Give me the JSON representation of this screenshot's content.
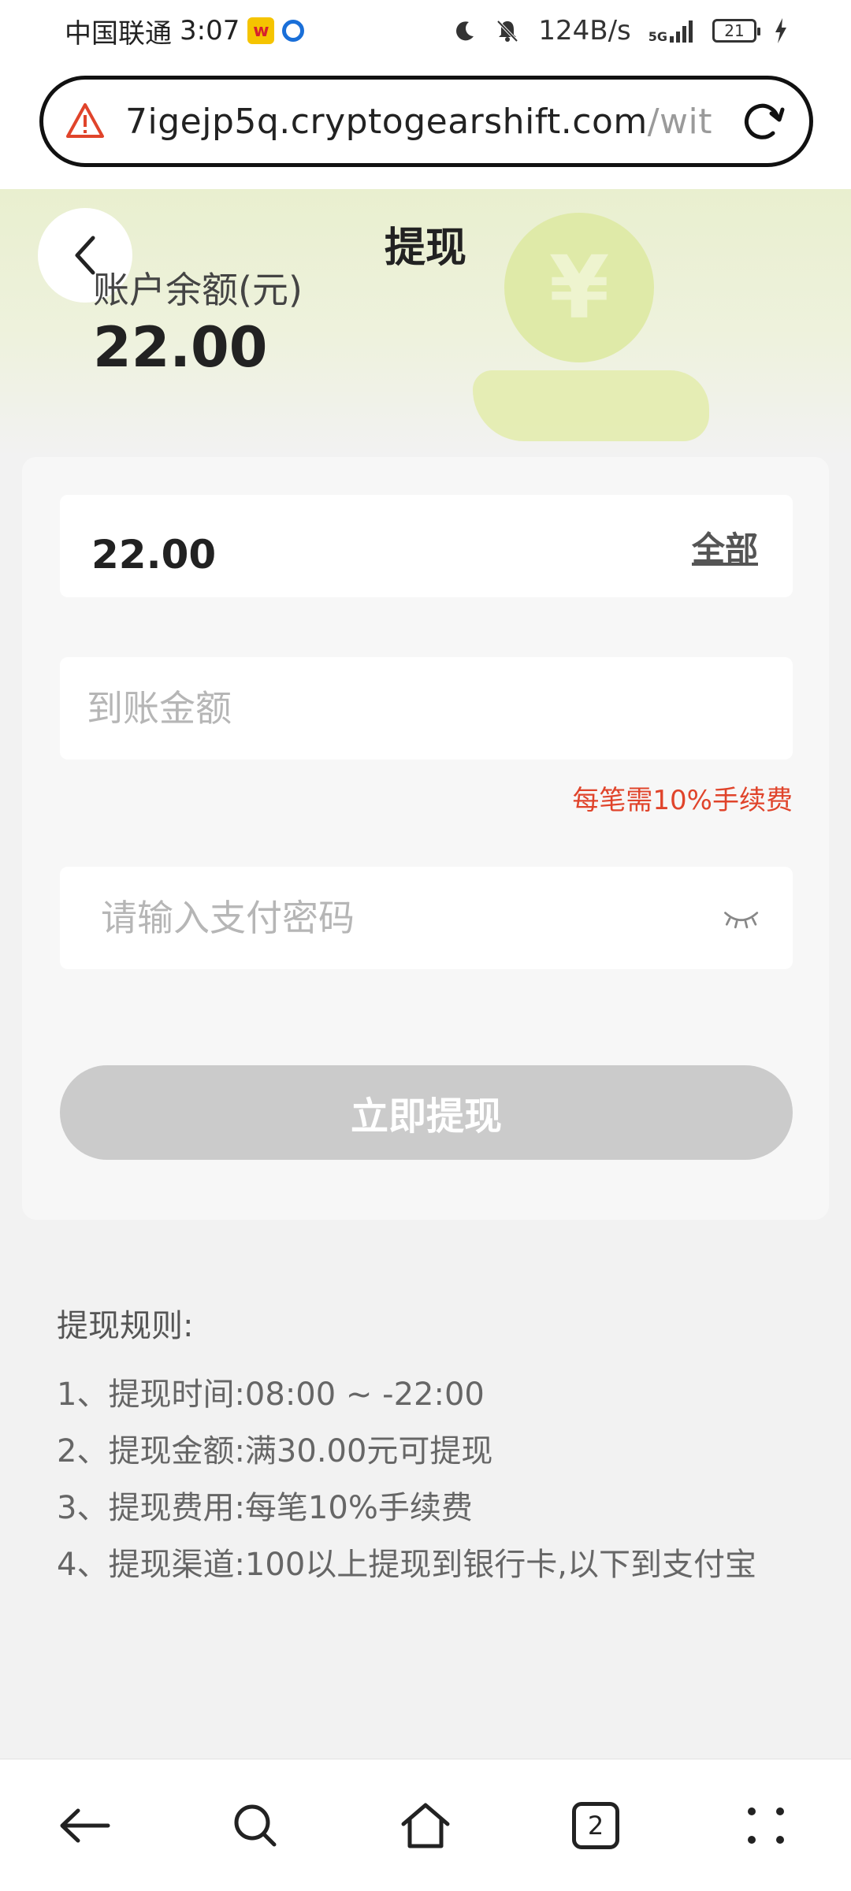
{
  "status_bar": {
    "carrier": "中国联通",
    "time": "3:07",
    "net_speed": "124B/s",
    "network": "5G",
    "battery": "21"
  },
  "browser": {
    "url_main": "7igejp5q.cryptogearshift.com",
    "url_rest": "/wit"
  },
  "header": {
    "title": "提现",
    "balance_label": "账户余额(元)",
    "balance_value": "22.00",
    "coin_symbol": "¥"
  },
  "form": {
    "amount_value": "22.00",
    "all_label": "全部",
    "arrive_placeholder": "到账金额",
    "fee_note": "每笔需10%手续费",
    "password_placeholder": "请输入支付密码",
    "submit_label": "立即提现"
  },
  "rules": {
    "title": "提现规则:",
    "items": [
      "1、提现时间:08:00 ~ -22:00",
      "2、提现金额:满30.00元可提现",
      "3、提现费用:每笔10%手续费",
      "4、提现渠道:100以上提现到银行卡,以下到支付宝"
    ]
  },
  "bottom_nav": {
    "tab_count": "2"
  },
  "colors": {
    "accent_red": "#e0442b",
    "button_disabled": "#cbcbcb",
    "header_green": "#e9efcf"
  }
}
